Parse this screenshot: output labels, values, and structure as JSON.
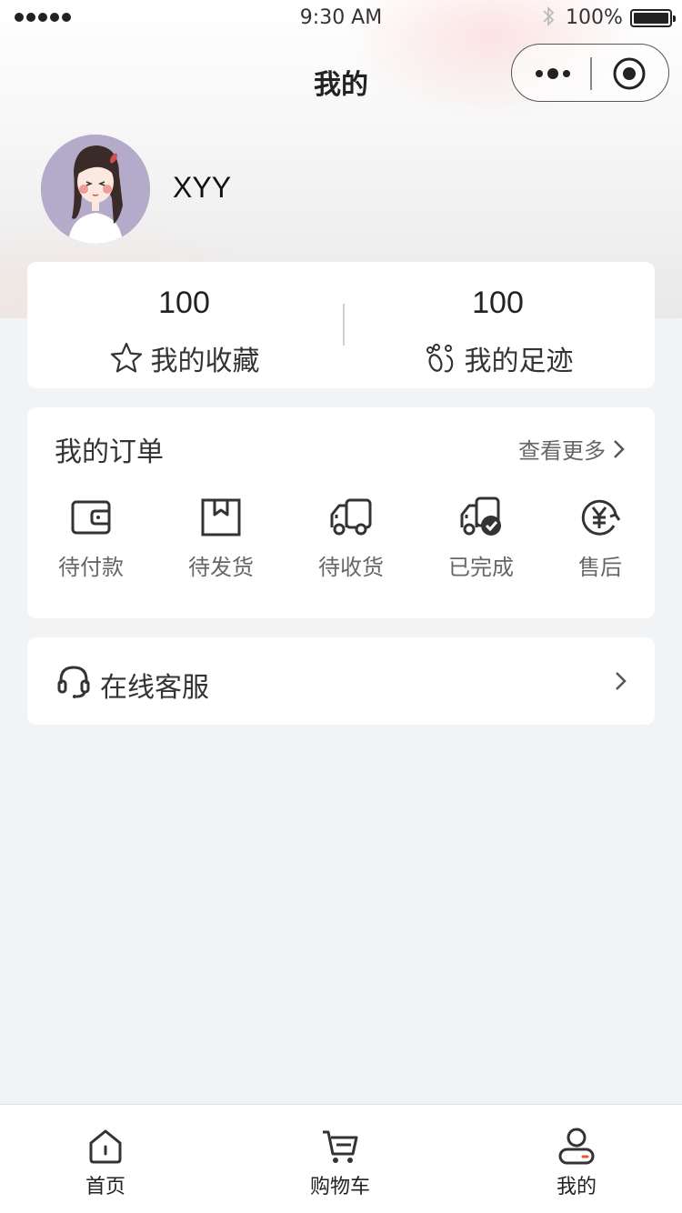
{
  "status_bar": {
    "time": "9:30 AM",
    "battery": "100%",
    "battery_level": 1.0,
    "signal_bars": 5
  },
  "nav": {
    "title": "我的",
    "capsule": {
      "more_icon": "more-dots-icon",
      "close_icon": "target-close-icon"
    }
  },
  "profile": {
    "username": "XYY",
    "avatar_icon": "avatar-girl-illustration"
  },
  "stats": [
    {
      "value": "100",
      "label": "我的收藏",
      "icon": "star-icon"
    },
    {
      "value": "100",
      "label": "我的足迹",
      "icon": "footprint-icon"
    }
  ],
  "orders": {
    "title": "我的订单",
    "more_label": "查看更多",
    "items": [
      {
        "label": "待付款",
        "icon": "wallet-icon"
      },
      {
        "label": "待发货",
        "icon": "package-icon"
      },
      {
        "label": "待收货",
        "icon": "truck-icon"
      },
      {
        "label": "已完成",
        "icon": "truck-check-icon"
      },
      {
        "label": "售后",
        "icon": "yen-refund-icon"
      }
    ]
  },
  "service": {
    "label": "在线客服",
    "icon": "headset-icon"
  },
  "tabbar": [
    {
      "label": "首页",
      "icon": "home-icon",
      "active": false
    },
    {
      "label": "购物车",
      "icon": "cart-icon",
      "active": false
    },
    {
      "label": "我的",
      "icon": "user-icon",
      "active": true
    }
  ],
  "colors": {
    "page_bg": "#f2f3f5",
    "card_bg": "#ffffff",
    "text_primary": "#222222",
    "text_secondary": "#666666",
    "accent": "#e8552e"
  }
}
